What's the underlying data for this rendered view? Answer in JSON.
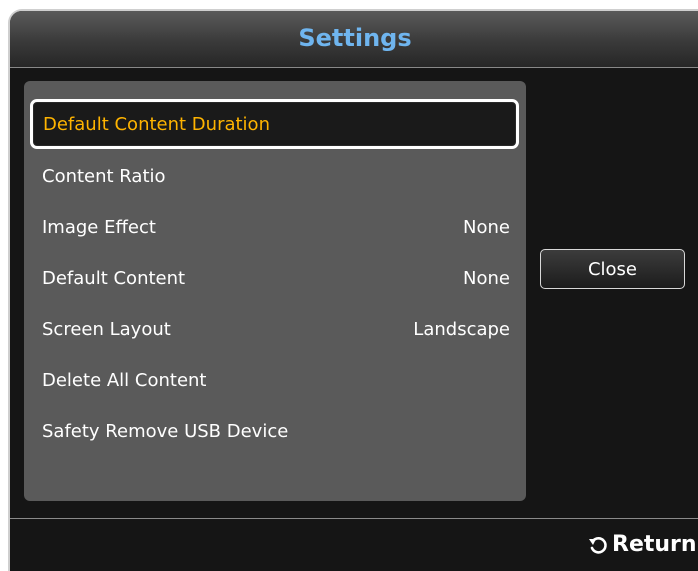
{
  "dialog": {
    "title": "Settings"
  },
  "menu": {
    "items": [
      {
        "label": "Default Content Duration",
        "value": "",
        "selected": true
      },
      {
        "label": "Content Ratio",
        "value": ""
      },
      {
        "label": "Image Effect",
        "value": "None"
      },
      {
        "label": "Default Content",
        "value": "None"
      },
      {
        "label": "Screen Layout",
        "value": "Landscape"
      },
      {
        "label": "Delete All Content",
        "value": ""
      },
      {
        "label": "Safety Remove USB Device",
        "value": ""
      }
    ]
  },
  "buttons": {
    "close_label": "Close"
  },
  "footer": {
    "return_label": "Return",
    "return_icon": "return-arrow-icon"
  },
  "colors": {
    "title": "#6fb5ef",
    "selected_text": "#ffb400",
    "panel": "#5a5a5a",
    "background": "#151515"
  }
}
